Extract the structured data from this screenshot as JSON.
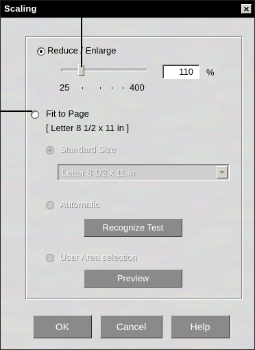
{
  "window": {
    "title": "Scaling",
    "close_glyph": "×"
  },
  "reduce_enlarge": {
    "label": "Reduce / Enlarge",
    "selected": true,
    "slider_min_label": "25",
    "slider_max_label": "400",
    "scale_value": "110",
    "unit": "%"
  },
  "fit_to_page": {
    "label": "Fit to Page",
    "selected": false,
    "paper_label": "[ Letter 8 1/2 x 11 in ]",
    "standard_size": {
      "label": "Standard Size",
      "selected": true,
      "enabled": false
    },
    "dropdown": {
      "value": "Letter 8 1/2 x 11 in",
      "enabled": false
    },
    "automatic": {
      "label": "Automatic",
      "enabled": false
    },
    "recognize_test_label": "Recognize Test",
    "user_area": {
      "label": "User Area selection",
      "enabled": false
    },
    "preview_label": "Preview"
  },
  "buttons": {
    "ok": "OK",
    "cancel": "Cancel",
    "help": "Help"
  },
  "colors": {
    "titlebar": "#000000",
    "dialog_bg": "#c8c8c8",
    "button_bg": "#8a8a8a",
    "disabled_text": "#f4f4f4"
  }
}
